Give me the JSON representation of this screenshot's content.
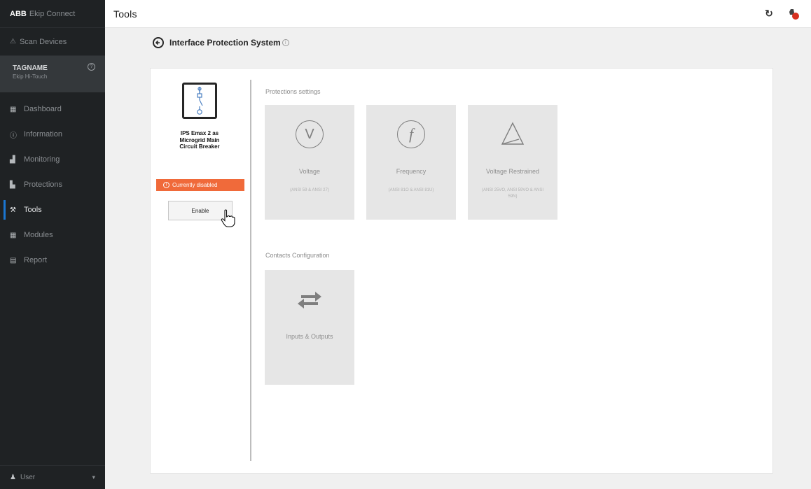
{
  "sidebar": {
    "brand": {
      "logo": "ABB",
      "app": "Ekip Connect"
    },
    "scan": {
      "label": "Scan Devices",
      "icon": "scan-icon"
    },
    "device": {
      "tag": "TAGNAME",
      "sub": "Ekip Hi-Touch"
    },
    "items": [
      {
        "label": "Dashboard",
        "icon": "dashboard-icon",
        "glyph": "▦"
      },
      {
        "label": "Information",
        "icon": "info-icon",
        "glyph": "ⓘ"
      },
      {
        "label": "Monitoring",
        "icon": "monitoring-icon",
        "glyph": "▟"
      },
      {
        "label": "Protections",
        "icon": "protections-icon",
        "glyph": "▙"
      },
      {
        "label": "Tools",
        "icon": "tools-icon",
        "glyph": "⚒"
      },
      {
        "label": "Modules",
        "icon": "modules-icon",
        "glyph": "▦"
      },
      {
        "label": "Report",
        "icon": "report-icon",
        "glyph": "▤"
      }
    ],
    "active_index": 4,
    "user": {
      "label": "User"
    }
  },
  "topbar": {
    "title": "Tools"
  },
  "header": {
    "title": "Interface Protection System"
  },
  "device_panel": {
    "name_lines": [
      "IPS Emax 2 as",
      "Microgrid Main",
      "Circuit Breaker"
    ],
    "status": "Currently disabled",
    "enable_label": "Enable"
  },
  "protections": {
    "title": "Protections settings",
    "tiles": [
      {
        "name": "Voltage",
        "desc": "(ANSI 59 & ANSI 27)",
        "icon": "voltage-icon"
      },
      {
        "name": "Frequency",
        "desc": "(ANSI 81O & ANSI 81U)",
        "icon": "frequency-icon"
      },
      {
        "name": "Voltage Restrained",
        "desc": "(ANSI 25VO, ANSI 59VO & ANSI 59N)",
        "icon": "voltage-restrained-icon"
      }
    ]
  },
  "contacts": {
    "title": "Contacts Configuration",
    "tiles": [
      {
        "name": "Inputs & Outputs",
        "icon": "swap-arrows-icon"
      }
    ]
  },
  "colors": {
    "sidebar_bg": "#1f2224",
    "accent": "#1b76d1",
    "warning": "#f06a3a",
    "tile_bg": "#e6e6e6"
  }
}
